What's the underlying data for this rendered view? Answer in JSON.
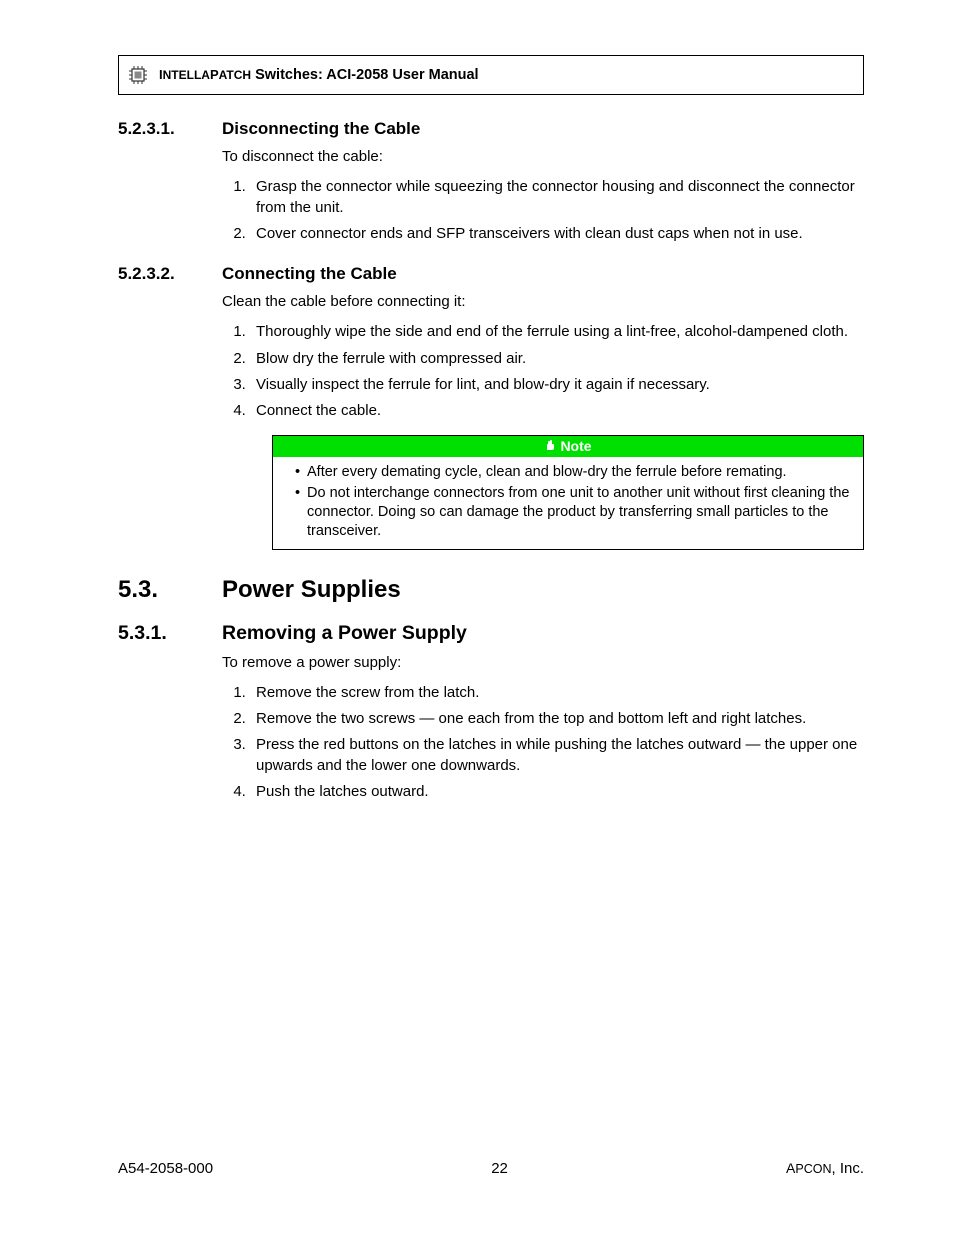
{
  "header": {
    "brand_sc": "IntellaPatch",
    "rest": " Switches: ACI-2058 User Manual"
  },
  "s5231": {
    "num": "5.2.3.1.",
    "title": "Disconnecting the Cable",
    "intro": "To disconnect the cable:",
    "items": [
      "Grasp the connector while squeezing the connector housing and disconnect the connector from the unit.",
      "Cover connector ends and SFP transceivers with clean dust caps when not in use."
    ]
  },
  "s5232": {
    "num": "5.2.3.2.",
    "title": "Connecting the Cable",
    "intro": "Clean the cable before connecting it:",
    "items": [
      "Thoroughly wipe the side and end of the ferrule using a lint-free, alcohol-dampened cloth.",
      "Blow dry the ferrule with compressed air.",
      "Visually inspect the ferrule for lint, and blow-dry it again if necessary.",
      "Connect the cable."
    ]
  },
  "note": {
    "label": "Note",
    "items": [
      "After every demating cycle, clean and blow-dry the ferrule before remating.",
      "Do not interchange connectors from one unit to another unit without first cleaning the connector. Doing so can damage the product by transferring small particles to the transceiver."
    ]
  },
  "s53": {
    "num": "5.3.",
    "title": "Power Supplies"
  },
  "s531": {
    "num": "5.3.1.",
    "title": "Removing a Power Supply",
    "intro": "To remove a power supply:",
    "items": [
      "Remove the screw from the latch.",
      "Remove the two screws — one each from the top and bottom left and right latches.",
      "Press the red buttons on the latches in while pushing the latches outward — the upper one upwards and the lower one downwards.",
      "Push the latches outward."
    ]
  },
  "footer": {
    "left": "A54-2058-000",
    "center": "22",
    "right_sc": "Apcon",
    "right_rest": ", Inc."
  }
}
